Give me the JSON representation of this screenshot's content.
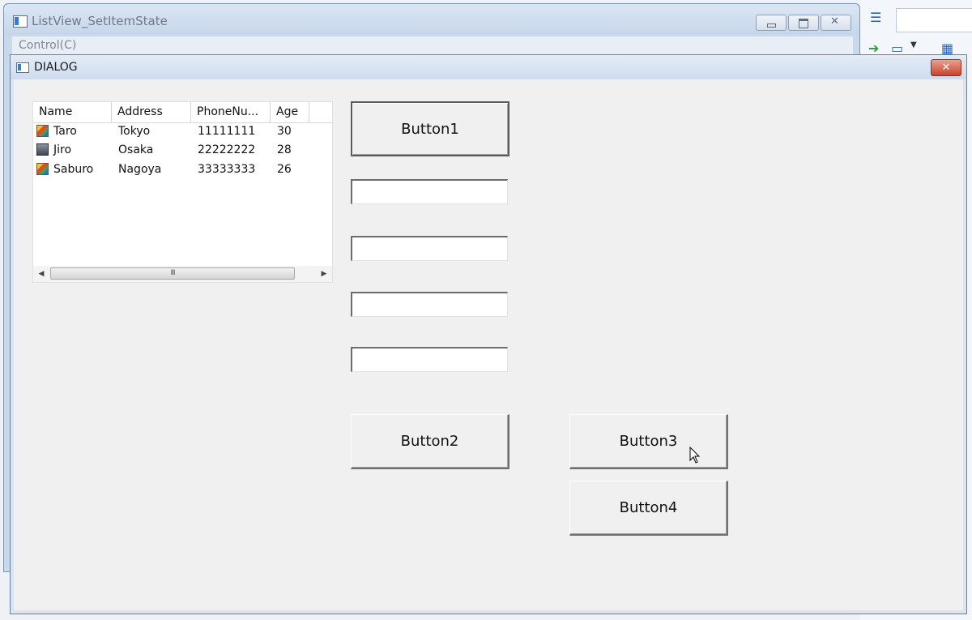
{
  "parent_window": {
    "title": "ListView_SetItemState",
    "menu": [
      "Control(C)"
    ]
  },
  "dialog": {
    "title": "DIALOG",
    "close_glyph": "✕"
  },
  "listview": {
    "columns": [
      "Name",
      "Address",
      "PhoneNu...",
      "Age"
    ],
    "rows": [
      {
        "icon": "edit-icon",
        "name": "Taro",
        "address": "Tokyo",
        "phone": "11111111",
        "age": "30"
      },
      {
        "icon": "photo-icon",
        "name": "Jiro",
        "address": "Osaka",
        "phone": "22222222",
        "age": "28"
      },
      {
        "icon": "edit-icon",
        "name": "Saburo",
        "address": "Nagoya",
        "phone": "33333333",
        "age": "26"
      }
    ],
    "scroll_thumb_glyph": "III"
  },
  "buttons": {
    "button1": "Button1",
    "button2": "Button2",
    "button3": "Button3",
    "button4": "Button4"
  },
  "edits": {
    "edit1": "",
    "edit2": "",
    "edit3": "",
    "edit4": ""
  }
}
